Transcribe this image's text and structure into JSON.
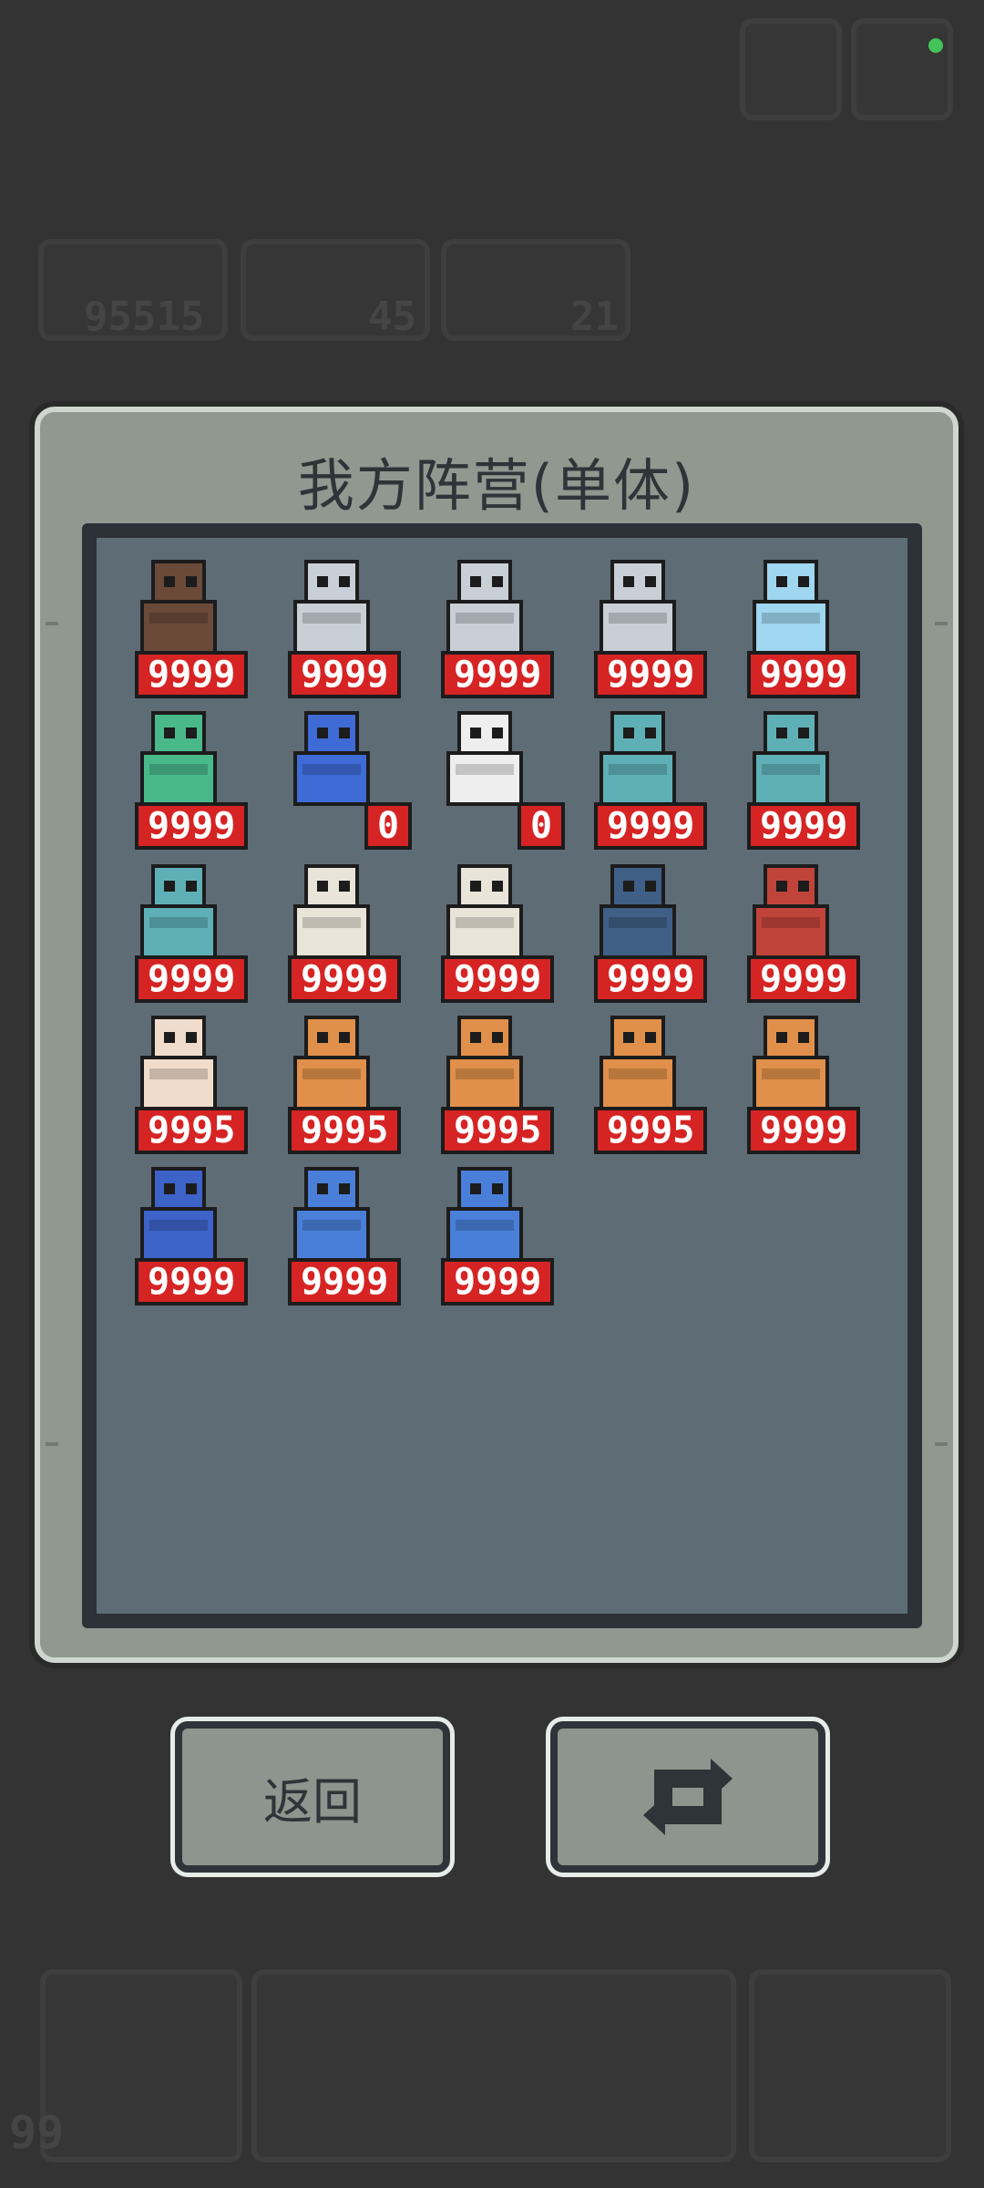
{
  "background": {
    "resource_counts": [
      "95515",
      "45",
      "21"
    ],
    "bottom_count": "99"
  },
  "dialog": {
    "title": "我方阵营(单体)"
  },
  "units": [
    {
      "name": "tree-root-creature",
      "count": "9999",
      "color": "#6b4a3a"
    },
    {
      "name": "eye-orb-guardian",
      "count": "9999",
      "color": "#c9cfd6"
    },
    {
      "name": "eye-orb-guardian",
      "count": "9999",
      "color": "#c9cfd6"
    },
    {
      "name": "eye-orb-guardian",
      "count": "9999",
      "color": "#c9cfd6"
    },
    {
      "name": "ice-flame-spirit",
      "count": "9999",
      "color": "#9fd6f0"
    },
    {
      "name": "green-mantis-golem",
      "count": "9999",
      "color": "#49b98a"
    },
    {
      "name": "blue-crystal-cluster",
      "count": "0",
      "color": "#3f6bd6"
    },
    {
      "name": "white-ghost",
      "count": "0",
      "color": "#eeeeee"
    },
    {
      "name": "orange-haired-zombie",
      "count": "9999",
      "color": "#5fb0b6"
    },
    {
      "name": "orange-haired-zombie",
      "count": "9999",
      "color": "#5fb0b6"
    },
    {
      "name": "orange-haired-zombie",
      "count": "9999",
      "color": "#5fb0b6"
    },
    {
      "name": "white-haired-elder",
      "count": "9999",
      "color": "#e9e4d8"
    },
    {
      "name": "white-haired-elder",
      "count": "9999",
      "color": "#e9e4d8"
    },
    {
      "name": "spiked-blue-beast",
      "count": "9999",
      "color": "#3f5f86"
    },
    {
      "name": "red-maw-plant",
      "count": "9999",
      "color": "#c0443a"
    },
    {
      "name": "glasses-scientist",
      "count": "9995",
      "color": "#f1dccb"
    },
    {
      "name": "orange-head-brute",
      "count": "9995",
      "color": "#e0904a"
    },
    {
      "name": "orange-head-brute",
      "count": "9995",
      "color": "#e0904a"
    },
    {
      "name": "orange-head-brute",
      "count": "9995",
      "color": "#e0904a"
    },
    {
      "name": "orange-head-brute",
      "count": "9999",
      "color": "#e0904a"
    },
    {
      "name": "blue-trash-can",
      "count": "9999",
      "color": "#3d63c9"
    },
    {
      "name": "blue-cyclops-blob",
      "count": "9999",
      "color": "#4a7fd9"
    },
    {
      "name": "blue-cyclops-blob",
      "count": "9999",
      "color": "#4a7fd9"
    }
  ],
  "buttons": {
    "back_label": "返回",
    "refresh_icon": "refresh-icon"
  }
}
